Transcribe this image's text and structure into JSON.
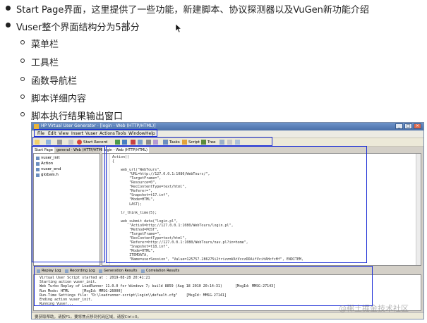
{
  "slide": {
    "bullet1": "Start Page界面，这里提供了一些功能，新建脚本、协议探测器以及VuGen新功能介绍",
    "bullet2": "Vuser整个界面结构分为5部分",
    "sub_items": [
      "菜单栏",
      "工具栏",
      "函数导航栏",
      "脚本详细内容",
      "脚本执行结果输出窗口"
    ]
  },
  "window": {
    "title": "HP Virtual User Generator - [login - Web (HTTP/HTML)]",
    "menu": [
      "File",
      "Edit",
      "View",
      "Insert",
      "Vuser",
      "Actions",
      "Tools",
      "Window",
      "Help"
    ],
    "toolbar": {
      "start_record": "Start Record",
      "tasks": "Tasks",
      "script": "Script",
      "tree": "Tree"
    },
    "tabs": {
      "start_page": "Start Page",
      "general": "general - Web (HTTP/HTML)",
      "login": "login - Web (HTTP/HTML)"
    },
    "left_pane": [
      "vuser_init",
      "Action",
      "vuser_end",
      "globals.h"
    ],
    "code_lines": [
      "Action()",
      "{",
      "",
      "    web_url(\"WebTours\",",
      "        \"URL=http://127.0.0.1:1080/WebTours/\",",
      "        \"TargetFrame=\",",
      "        \"Resource=0\",",
      "        \"RecContentType=text/html\",",
      "        \"Referer=\",",
      "        \"Snapshot=t17.inf\",",
      "        \"Mode=HTML\",",
      "        LAST);",
      "",
      "    lr_think_time(5);",
      "",
      "    web_submit_data(\"login.pl\",",
      "        \"Action=http://127.0.0.1:1080/WebTours/login.pl\",",
      "        \"Method=POST\",",
      "        \"TargetFrame=\",",
      "        \"RecContentType=text/html\",",
      "        \"Referer=http://127.0.0.1:1080/WebTours/nav.pl?in=home\",",
      "        \"Snapshot=t18.inf\",",
      "        \"Mode=HTML\",",
      "        ITEMDATA,",
      "        \"Name=userSession\", \"Value=125757.286275i2trizzmVAtVcczDDAifVcitAHcfcHf\", ENDITEM,"
    ],
    "output_tabs": [
      "Replay Log",
      "Recording Log",
      "Generation Results",
      "Correlation Results"
    ],
    "output_lines": [
      "Virtual User Script started at : 2019-08-28 20:41:21",
      "Starting action vuser_init.",
      "Web Turbo Replay of LoadRunner 11.0.0 for Windows 7; build 8859 (Aug 18 2010 20:14:31)      [MsgId: MMSG-27143]",
      "Run Mode: HTML      [MsgId: MMSG-26000]",
      "Run-Time Settings file: \"D:\\loadrunner-script\\login\\\\default.cfg\"    [MsgId: MMSG-27141]",
      "Ending action vuser_init.",
      "Running Vuser..."
    ],
    "status": "要获取帮助，请按F1。要将焦点移到代码区域，请按Ctrl+0。"
  },
  "watermark": "@稀土掘金技术社区",
  "colors": {
    "highlight": "#1d2fd6",
    "titlebar": "#4a6fa8"
  }
}
